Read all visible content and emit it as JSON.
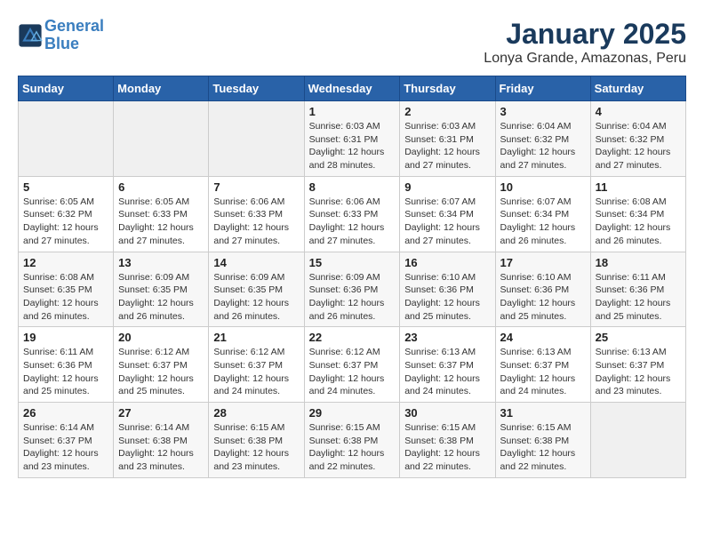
{
  "header": {
    "logo_line1": "General",
    "logo_line2": "Blue",
    "title": "January 2025",
    "subtitle": "Lonya Grande, Amazonas, Peru"
  },
  "weekdays": [
    "Sunday",
    "Monday",
    "Tuesday",
    "Wednesday",
    "Thursday",
    "Friday",
    "Saturday"
  ],
  "weeks": [
    [
      {
        "day": "",
        "info": ""
      },
      {
        "day": "",
        "info": ""
      },
      {
        "day": "",
        "info": ""
      },
      {
        "day": "1",
        "info": "Sunrise: 6:03 AM\nSunset: 6:31 PM\nDaylight: 12 hours and 28 minutes."
      },
      {
        "day": "2",
        "info": "Sunrise: 6:03 AM\nSunset: 6:31 PM\nDaylight: 12 hours and 27 minutes."
      },
      {
        "day": "3",
        "info": "Sunrise: 6:04 AM\nSunset: 6:32 PM\nDaylight: 12 hours and 27 minutes."
      },
      {
        "day": "4",
        "info": "Sunrise: 6:04 AM\nSunset: 6:32 PM\nDaylight: 12 hours and 27 minutes."
      }
    ],
    [
      {
        "day": "5",
        "info": "Sunrise: 6:05 AM\nSunset: 6:32 PM\nDaylight: 12 hours and 27 minutes."
      },
      {
        "day": "6",
        "info": "Sunrise: 6:05 AM\nSunset: 6:33 PM\nDaylight: 12 hours and 27 minutes."
      },
      {
        "day": "7",
        "info": "Sunrise: 6:06 AM\nSunset: 6:33 PM\nDaylight: 12 hours and 27 minutes."
      },
      {
        "day": "8",
        "info": "Sunrise: 6:06 AM\nSunset: 6:33 PM\nDaylight: 12 hours and 27 minutes."
      },
      {
        "day": "9",
        "info": "Sunrise: 6:07 AM\nSunset: 6:34 PM\nDaylight: 12 hours and 27 minutes."
      },
      {
        "day": "10",
        "info": "Sunrise: 6:07 AM\nSunset: 6:34 PM\nDaylight: 12 hours and 26 minutes."
      },
      {
        "day": "11",
        "info": "Sunrise: 6:08 AM\nSunset: 6:34 PM\nDaylight: 12 hours and 26 minutes."
      }
    ],
    [
      {
        "day": "12",
        "info": "Sunrise: 6:08 AM\nSunset: 6:35 PM\nDaylight: 12 hours and 26 minutes."
      },
      {
        "day": "13",
        "info": "Sunrise: 6:09 AM\nSunset: 6:35 PM\nDaylight: 12 hours and 26 minutes."
      },
      {
        "day": "14",
        "info": "Sunrise: 6:09 AM\nSunset: 6:35 PM\nDaylight: 12 hours and 26 minutes."
      },
      {
        "day": "15",
        "info": "Sunrise: 6:09 AM\nSunset: 6:36 PM\nDaylight: 12 hours and 26 minutes."
      },
      {
        "day": "16",
        "info": "Sunrise: 6:10 AM\nSunset: 6:36 PM\nDaylight: 12 hours and 25 minutes."
      },
      {
        "day": "17",
        "info": "Sunrise: 6:10 AM\nSunset: 6:36 PM\nDaylight: 12 hours and 25 minutes."
      },
      {
        "day": "18",
        "info": "Sunrise: 6:11 AM\nSunset: 6:36 PM\nDaylight: 12 hours and 25 minutes."
      }
    ],
    [
      {
        "day": "19",
        "info": "Sunrise: 6:11 AM\nSunset: 6:36 PM\nDaylight: 12 hours and 25 minutes."
      },
      {
        "day": "20",
        "info": "Sunrise: 6:12 AM\nSunset: 6:37 PM\nDaylight: 12 hours and 25 minutes."
      },
      {
        "day": "21",
        "info": "Sunrise: 6:12 AM\nSunset: 6:37 PM\nDaylight: 12 hours and 24 minutes."
      },
      {
        "day": "22",
        "info": "Sunrise: 6:12 AM\nSunset: 6:37 PM\nDaylight: 12 hours and 24 minutes."
      },
      {
        "day": "23",
        "info": "Sunrise: 6:13 AM\nSunset: 6:37 PM\nDaylight: 12 hours and 24 minutes."
      },
      {
        "day": "24",
        "info": "Sunrise: 6:13 AM\nSunset: 6:37 PM\nDaylight: 12 hours and 24 minutes."
      },
      {
        "day": "25",
        "info": "Sunrise: 6:13 AM\nSunset: 6:37 PM\nDaylight: 12 hours and 23 minutes."
      }
    ],
    [
      {
        "day": "26",
        "info": "Sunrise: 6:14 AM\nSunset: 6:37 PM\nDaylight: 12 hours and 23 minutes."
      },
      {
        "day": "27",
        "info": "Sunrise: 6:14 AM\nSunset: 6:38 PM\nDaylight: 12 hours and 23 minutes."
      },
      {
        "day": "28",
        "info": "Sunrise: 6:15 AM\nSunset: 6:38 PM\nDaylight: 12 hours and 23 minutes."
      },
      {
        "day": "29",
        "info": "Sunrise: 6:15 AM\nSunset: 6:38 PM\nDaylight: 12 hours and 22 minutes."
      },
      {
        "day": "30",
        "info": "Sunrise: 6:15 AM\nSunset: 6:38 PM\nDaylight: 12 hours and 22 minutes."
      },
      {
        "day": "31",
        "info": "Sunrise: 6:15 AM\nSunset: 6:38 PM\nDaylight: 12 hours and 22 minutes."
      },
      {
        "day": "",
        "info": ""
      }
    ]
  ]
}
